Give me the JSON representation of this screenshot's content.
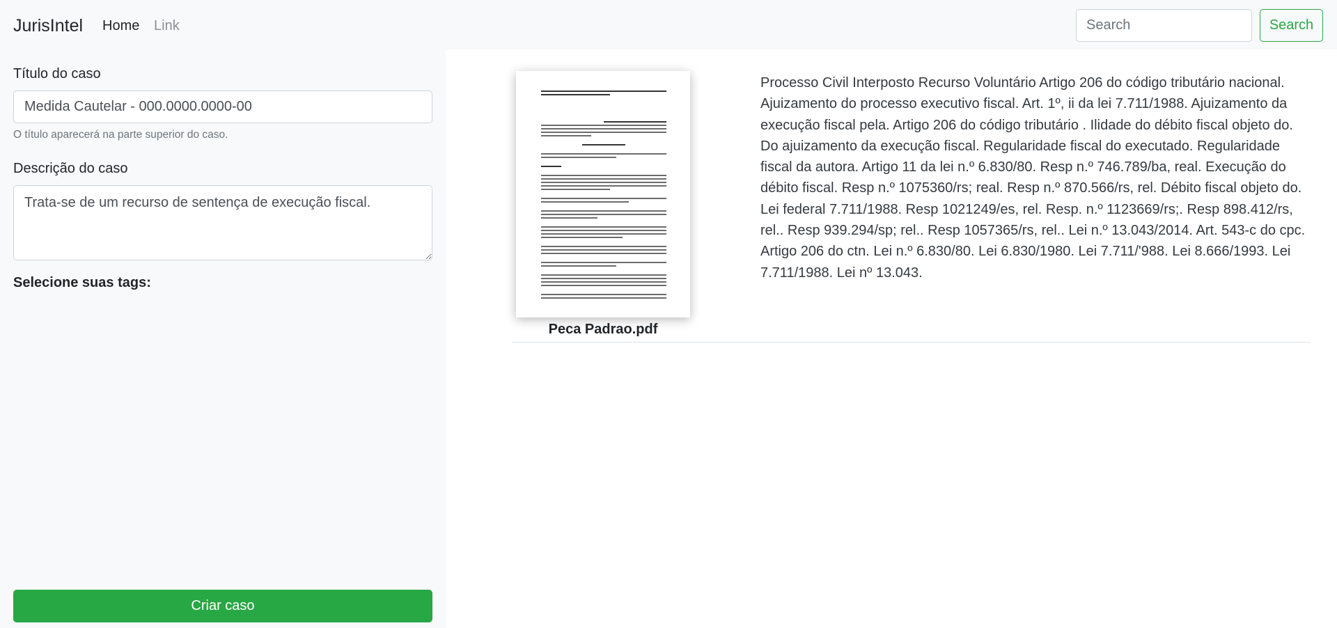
{
  "navbar": {
    "brand": "JurisIntel",
    "links": [
      "Home",
      "Link"
    ],
    "search_placeholder": "Search",
    "search_button": "Search"
  },
  "sidebar": {
    "title_label": "Título do caso",
    "title_value": "Medida Cautelar - 000.0000.0000-00",
    "title_help": "O título aparecerá na parte superior do caso.",
    "description_label": "Descrição do caso",
    "description_value": "Trata-se de um recurso de sentença de execução fiscal.",
    "tags_label": "Selecione suas tags:",
    "create_button": "Criar caso"
  },
  "document": {
    "filename": "Peca Padrao.pdf",
    "summary": "Processo Civil Interposto Recurso Voluntário Artigo 206 do código tributário nacional. Ajuizamento do processo executivo fiscal. Art. 1º, ii da lei 7.711/1988. Ajuizamento da execução fiscal pela. Artigo 206 do código tributário . Ilidade do débito fiscal objeto do. Do ajuizamento da execução fiscal. Regularidade fiscal do executado. Regularidade fiscal da autora. Artigo 11 da lei n.º 6.830/80. Resp n.º 746.789/ba, real. Execução do débito fiscal. Resp n.º 1075360/rs; real. Resp n.º 870.566/rs, rel. Débito fiscal objeto do. Lei federal 7.711/1988. Resp 1021249/es, rel. Resp. n.º 1123669/rs;. Resp 898.412/rs, rel.. Resp 939.294/sp; rel.. Resp 1057365/rs, rel.. Lei n.º 13.043/2014. Art. 543-c do cpc. Artigo 206 do ctn. Lei n.º 6.830/80. Lei 6.830/1980. Lei 7.711/'988. Lei 8.666/1993. Lei 7.711/1988. Lei nº 13.043."
  },
  "colors": {
    "accent": "#28a745",
    "sidebar_bg": "#f8f9fa",
    "navbar_bg": "#f8f9fa"
  }
}
